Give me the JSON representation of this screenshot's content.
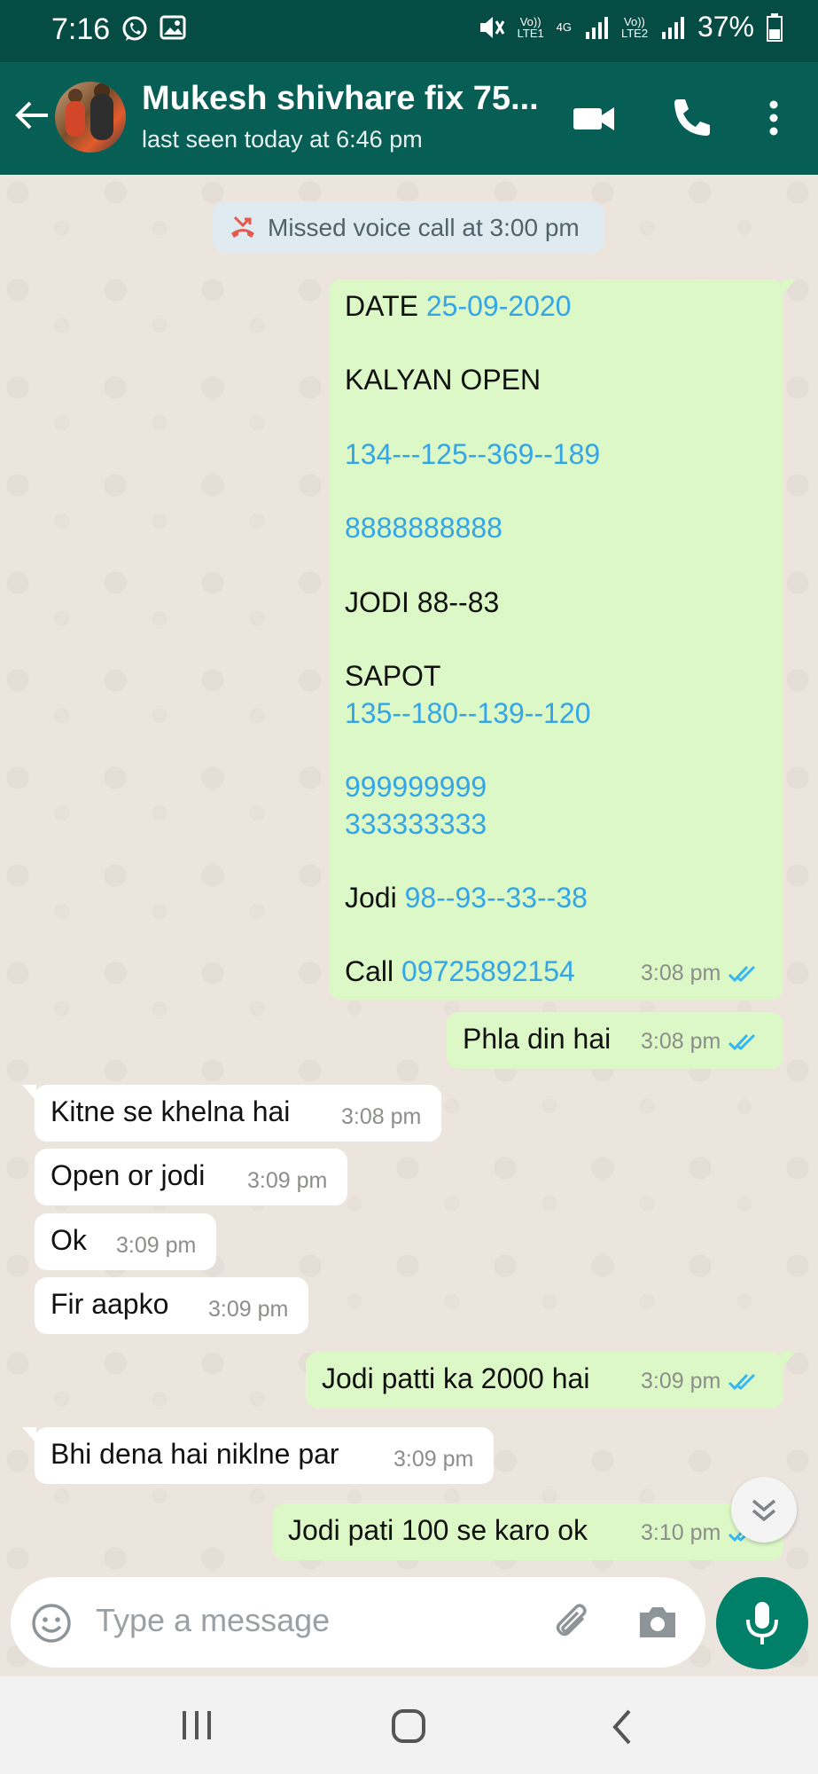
{
  "status_bar": {
    "time": "7:16",
    "net1": "Vo)) LTE1",
    "net_4g": "4G",
    "net2": "Vo)) LTE2",
    "battery": "37%"
  },
  "header": {
    "contact_name": "Mukesh shivhare fix 75...",
    "last_seen": "last seen today at 6:46 pm"
  },
  "system_message": "Missed voice call at 3:00 pm",
  "messages": {
    "m1": {
      "date_label": "DATE ",
      "date_value": "25-09-2020",
      "line_kalyan": "KALYAN  OPEN",
      "line_nums1": "134---125--369--189",
      "line_eights": "8888888888",
      "line_jodi": "JODI 88--83",
      "line_sapot": "SAPOT",
      "line_nums2": "135--180--139--120",
      "line_nines": "999999999",
      "line_threes": "333333333",
      "jodi_label": "Jodi ",
      "jodi_value": "98--93--33--38",
      "call_label": "Call ",
      "call_value": "09725892154",
      "time": "3:08 pm"
    },
    "m2": {
      "text": "Phla din hai",
      "time": "3:08 pm"
    },
    "m3": {
      "text": "Kitne se khelna hai",
      "time": "3:08 pm"
    },
    "m4": {
      "text": "Open or jodi",
      "time": "3:09 pm"
    },
    "m5": {
      "text": "Ok",
      "time": "3:09 pm"
    },
    "m6": {
      "text": "Fir aapko",
      "time": "3:09 pm"
    },
    "m7": {
      "text": "Jodi patti ka 2000 hai",
      "time": "3:09 pm"
    },
    "m8": {
      "text": "Bhi dena hai niklne par",
      "time": "3:09 pm"
    },
    "m9": {
      "text": "Jodi pati 100 se karo ok",
      "time": "3:10 pm"
    }
  },
  "composer": {
    "placeholder": "Type a message"
  },
  "colors": {
    "header": "#075e54",
    "outgoing": "#dcf8c6",
    "incoming": "#ffffff",
    "link": "#34a5e6",
    "read_ticks": "#34b7f1",
    "fab": "#008069"
  }
}
